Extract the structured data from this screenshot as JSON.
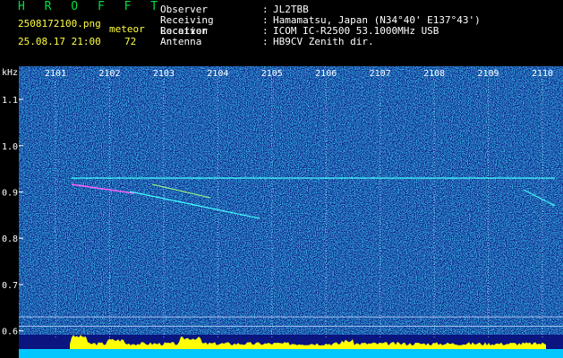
{
  "header": {
    "title": "H R O F F T",
    "filename": "2508172100.png",
    "datetime": "25.08.17 21:00",
    "meteor_label": "meteor",
    "meteor_count": "72",
    "info": [
      {
        "key": "Observer",
        "sep": ":",
        "value": "JL2TBB"
      },
      {
        "key": "Receiving Location",
        "sep": ":",
        "value": "Hamamatsu, Japan (N34°40' E137°43')"
      },
      {
        "key": "Receiver",
        "sep": ":",
        "value": "ICOM IC-R2500 53.1000MHz USB"
      },
      {
        "key": "Antenna",
        "sep": ":",
        "value": "HB9CV Zenith dir."
      }
    ]
  },
  "colors": {
    "background": "#000000",
    "plot_background": "#0a1580",
    "title": "#00e040",
    "header_text": "#ffff40",
    "grid": "#c8d8ff",
    "signal": "#40ffff",
    "histogram": "#ffff00",
    "histogram_base": "#00c8ff"
  },
  "chart_data": {
    "type": "heatmap",
    "yunit": "kHz",
    "x_ticks": [
      "2101",
      "2102",
      "2103",
      "2104",
      "2105",
      "2106",
      "2107",
      "2108",
      "2109",
      "2110"
    ],
    "y_ticks": [
      "1.1",
      "1.0",
      "0.9",
      "0.8",
      "0.7",
      "0.6"
    ],
    "ylim": [
      0.58,
      1.16
    ],
    "grid": true,
    "carrier_khz": 0.93
  }
}
